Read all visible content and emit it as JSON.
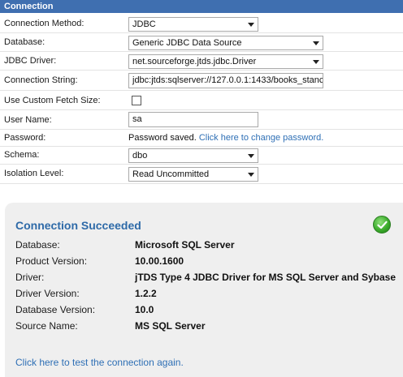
{
  "header": {
    "title": "Connection"
  },
  "form": {
    "connection_method": {
      "label": "Connection Method:",
      "value": "JDBC"
    },
    "database": {
      "label": "Database:",
      "value": "Generic JDBC Data Source"
    },
    "jdbc_driver": {
      "label": "JDBC Driver:",
      "value": "net.sourceforge.jtds.jdbc.Driver"
    },
    "connection_string": {
      "label": "Connection String:",
      "value": "jdbc:jtds:sqlserver://127.0.0.1:1433/books_stanc"
    },
    "custom_fetch": {
      "label": "Use Custom Fetch Size:",
      "checked": false
    },
    "user_name": {
      "label": "User Name:",
      "value": "sa"
    },
    "password": {
      "label": "Password:",
      "saved_text": "Password saved.",
      "change_link": "Click here to change password."
    },
    "schema": {
      "label": "Schema:",
      "value": "dbo"
    },
    "isolation_level": {
      "label": "Isolation Level:",
      "value": "Read Uncommitted"
    }
  },
  "result": {
    "title": "Connection Succeeded",
    "status_icon": "check-circle-icon",
    "rows": [
      {
        "label": "Database:",
        "value": "Microsoft SQL Server"
      },
      {
        "label": "Product Version:",
        "value": "10.00.1600"
      },
      {
        "label": "Driver:",
        "value": "jTDS Type 4 JDBC Driver for MS SQL Server and Sybase"
      },
      {
        "label": "Driver Version:",
        "value": "1.2.2"
      },
      {
        "label": "Database Version:",
        "value": "10.0"
      },
      {
        "label": "Source Name:",
        "value": "MS SQL Server"
      }
    ],
    "retest_link": "Click here to test the connection again."
  },
  "colors": {
    "header_bg": "#3f6fb0",
    "link": "#2e6fb5",
    "title": "#2e6aa8",
    "panel_bg": "#efefef",
    "success": "#3cad2c"
  }
}
